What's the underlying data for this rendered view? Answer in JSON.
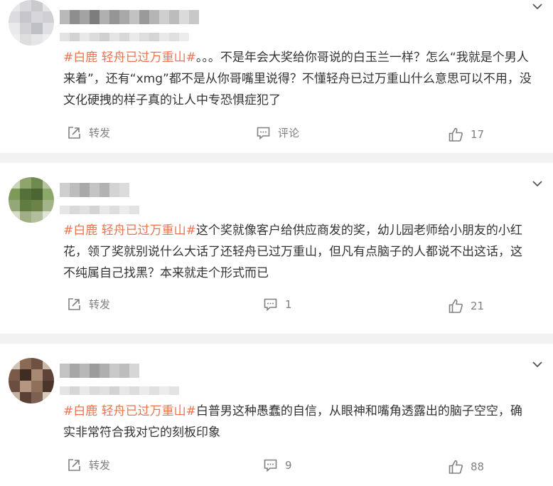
{
  "posts": [
    {
      "hashtag": "#白鹿 轻舟已过万重山#",
      "text": "。。。不是年会大奖给你哥说的白玉兰一样？怎么“我就是个男人来着”，还有“xmg”都不是从你哥嘴里说得？不懂轻舟已过万重山什么意思可以不用，没文化硬拽的样子真的让人中专恐惧症犯了",
      "forward_label": "转发",
      "comment_label": "评论",
      "like_count": "17"
    },
    {
      "hashtag": "#白鹿 轻舟已过万重山#",
      "text": "这个奖就像客户给供应商发的奖，幼儿园老师给小朋友的小红花，领了奖就别说什么大话了还轻舟已过万重山，但凡有点脑子的人都说不出这话，这不纯属自己找黑？本来就走个形式而已",
      "forward_label": "转发",
      "comment_label": "1",
      "like_count": "21"
    },
    {
      "hashtag": "#白鹿 轻舟已过万重山#",
      "text": "白普男这种愚蠢的自信，从眼神和嘴角透露出的脑子空空，确实非常符合我对它的刻板印象",
      "forward_label": "转发",
      "comment_label": "9",
      "like_count": "88"
    }
  ],
  "colors": {
    "hashtag": "#eb7350",
    "text": "#333333",
    "action": "#808080"
  },
  "icons": [
    "chevron-down-icon",
    "forward-icon",
    "comment-icon",
    "like-icon"
  ]
}
